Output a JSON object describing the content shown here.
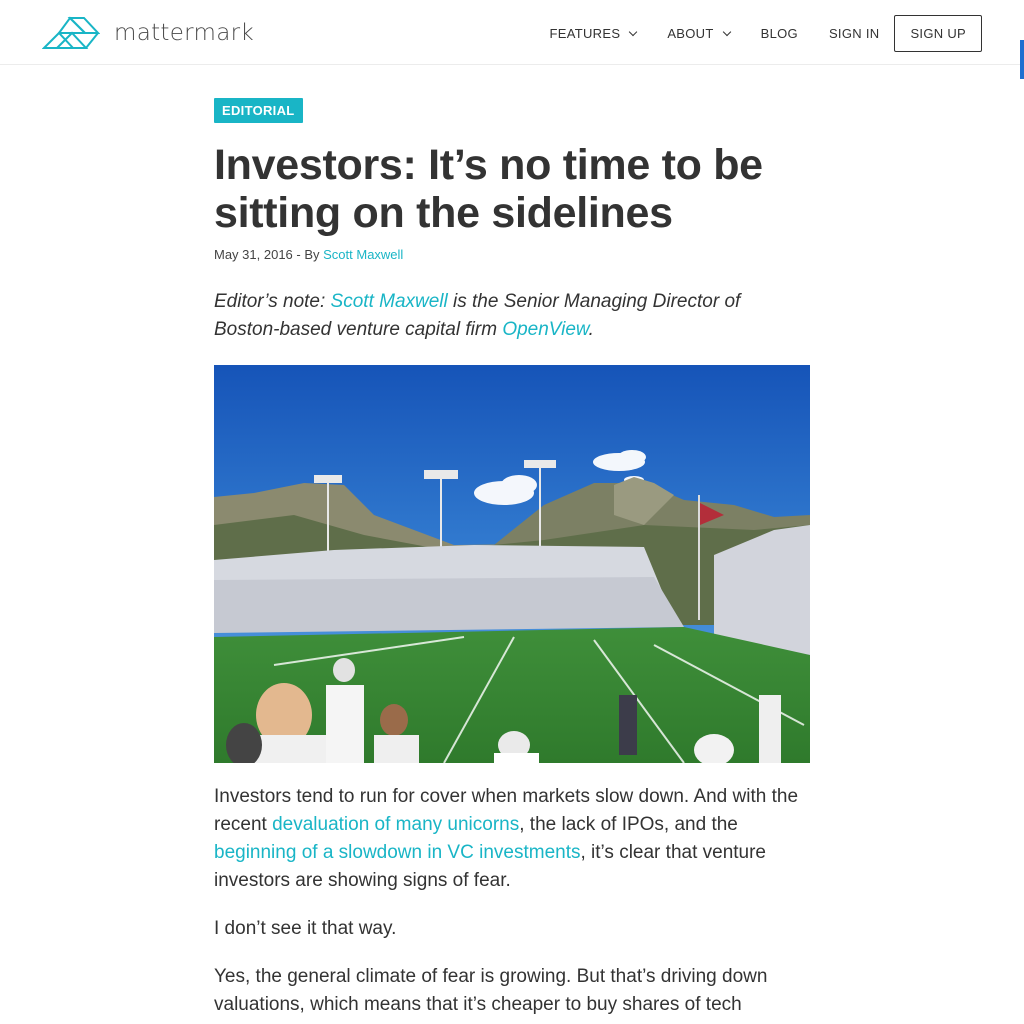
{
  "header": {
    "logo_text": "mattermark",
    "nav": [
      {
        "label": "FEATURES",
        "dropdown": true
      },
      {
        "label": "ABOUT",
        "dropdown": true
      },
      {
        "label": "BLOG",
        "dropdown": false
      },
      {
        "label": "SIGN IN",
        "dropdown": false
      }
    ],
    "signup_label": "SIGN UP"
  },
  "article": {
    "category": "EDITORIAL",
    "title": "Investors: It’s no time to be sitting on the sidelines",
    "date": "May 31, 2016",
    "by_prefix": " - By ",
    "author": "Scott Maxwell",
    "editor_note": {
      "prefix": "Editor’s note: ",
      "author_link": "Scott Maxwell",
      "middle": " is the Senior Managing Director of Boston-based venture capital firm ",
      "firm_link": "OpenView",
      "suffix": "."
    },
    "paragraph1": {
      "part1": "Investors tend to run for cover when markets slow down. And with the recent ",
      "link1": "devaluation of many unicorns",
      "part2": ", the lack of IPOs, and the ",
      "link2": "beginning of a slowdown in VC investments",
      "part3": ", it’s clear that venture investors are showing signs of fear."
    },
    "paragraph2": "I don’t see it that way.",
    "paragraph3": "Yes, the general climate of fear is growing. But that’s driving down valuations, which means that it’s cheaper to buy shares of tech"
  },
  "colors": {
    "accent": "#19b5c6",
    "text": "#333333",
    "side_tab": "#1e6fd0"
  },
  "icons": {
    "logo": "mattermark-logo-icon",
    "caret": "chevron-down-icon"
  }
}
